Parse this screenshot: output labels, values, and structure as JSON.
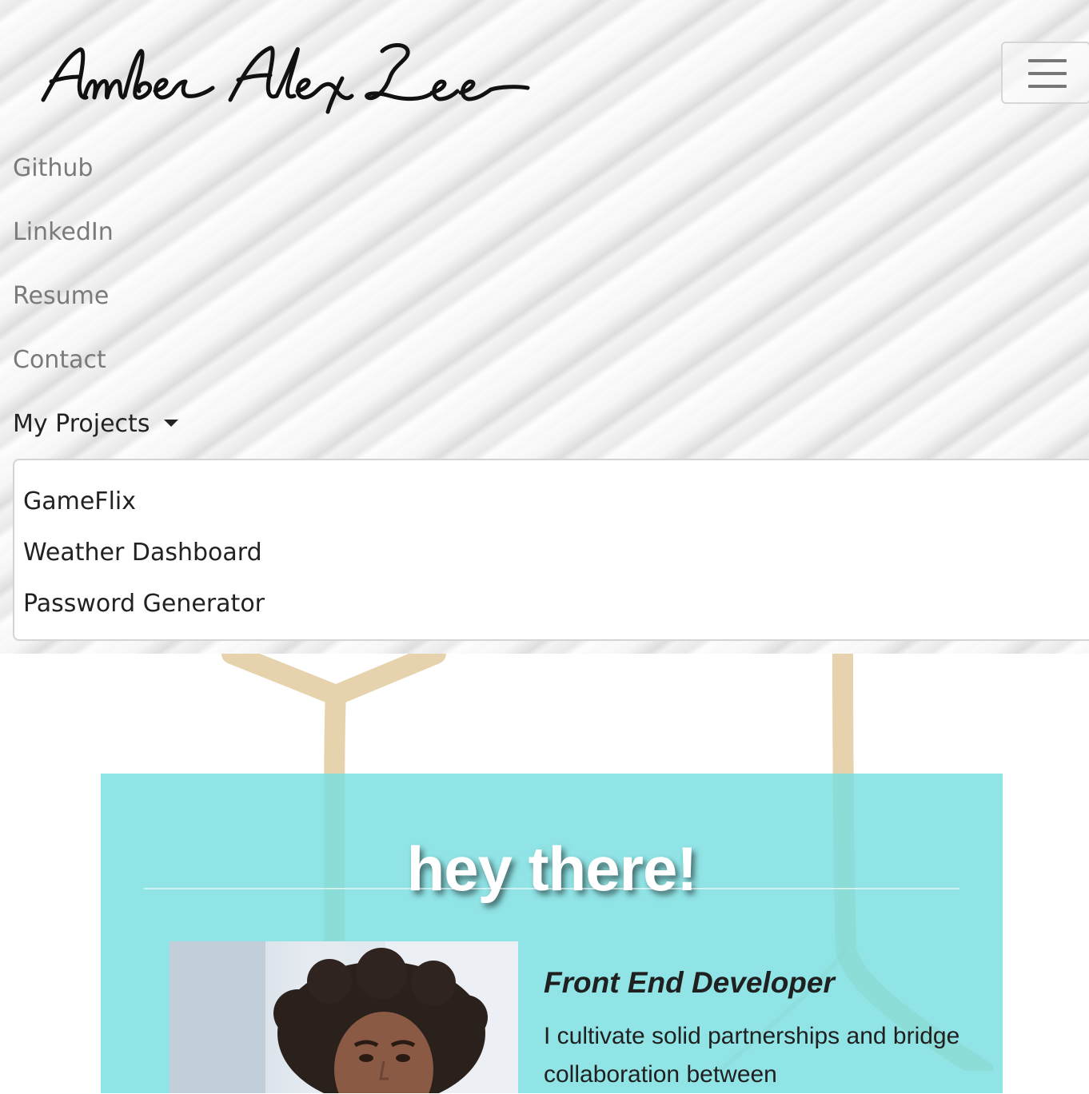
{
  "brand": {
    "name": "Amber Alex Lee"
  },
  "navbar": {
    "toggler_icon": "hamburger-icon",
    "links": [
      {
        "label": "Github"
      },
      {
        "label": "LinkedIn"
      },
      {
        "label": "Resume"
      },
      {
        "label": "Contact"
      }
    ],
    "projects_dropdown": {
      "label": "My Projects",
      "icon": "caret-down-icon",
      "expanded": true,
      "items": [
        {
          "label": "GameFlix"
        },
        {
          "label": "Weather Dashboard"
        },
        {
          "label": "Password Generator"
        }
      ]
    }
  },
  "hero": {
    "title": "hey there!",
    "role": "Front End Developer",
    "intro": "I cultivate solid partnerships and bridge collaboration between"
  },
  "colors": {
    "hero_card": "#8fe2e2",
    "nav_link": "#7a7a7a",
    "nav_link_active": "#232323",
    "hero_title": "#ffffff",
    "background_lines": "#e6d3ad"
  }
}
